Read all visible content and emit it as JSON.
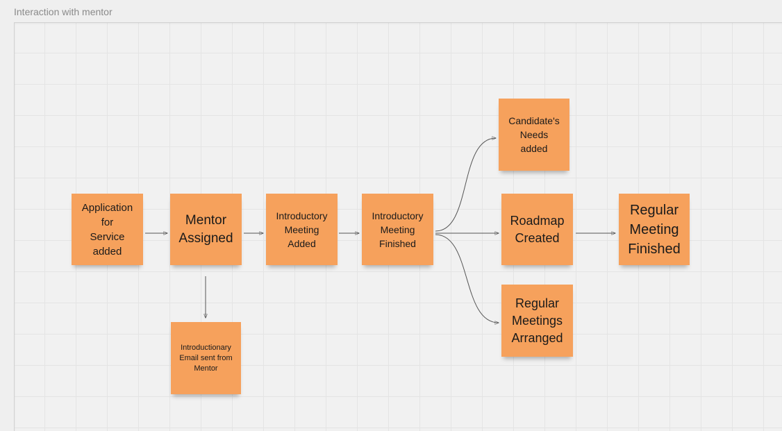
{
  "board": {
    "title": "Interaction with mentor"
  },
  "notes": {
    "application": "Application\nfor\nService\nadded",
    "mentor_assigned": "Mentor\nAssigned",
    "intro_email": "Introductionary\nEmail sent from\nMentor",
    "intro_meeting_added": "Introductory\nMeeting\nAdded",
    "intro_meeting_finished": "Introductory\nMeeting\nFinished",
    "candidates_needs": "Candidate's\nNeeds\nadded",
    "roadmap_created": "Roadmap\nCreated",
    "regular_meetings_arranged": "Regular\nMeetings\nArranged",
    "regular_meeting_finished": "Regular\nMeeting\nFinished"
  },
  "colors": {
    "sticky": "#f6a15c",
    "connector": "#555555"
  }
}
